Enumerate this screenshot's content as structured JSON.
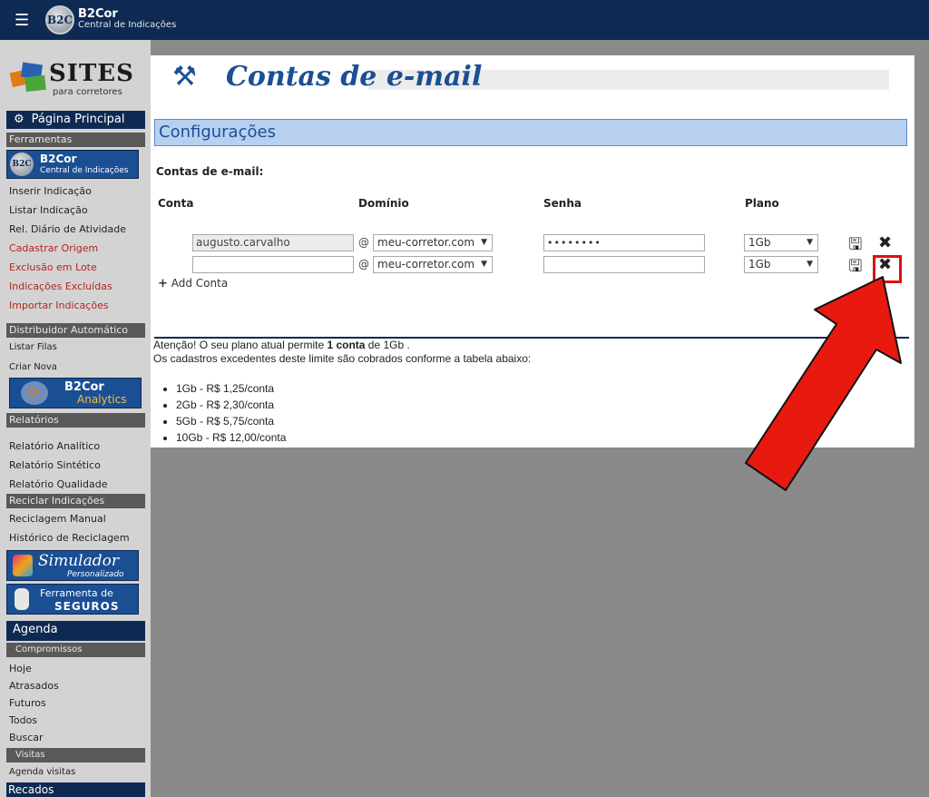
{
  "topbar": {
    "menu_icon": "hamburger-icon",
    "logo_text": "B2C",
    "brand_name": "B2Cor",
    "brand_sub": "Central de Indicações"
  },
  "sidebar": {
    "sites_logo": "SITES",
    "sites_sub": "para corretores",
    "home": "Página Principal",
    "ferramentas": "Ferramentas",
    "b2cor_banner": {
      "name": "B2Cor",
      "sub": "Central de Indicações"
    },
    "links_1": [
      "Inserir Indicação",
      "Listar Indicação",
      "Rel. Diário de Atividade"
    ],
    "links_red": [
      "Cadastrar Origem",
      "Exclusão em Lote",
      "Indicações Excluídas",
      "Importar Indicações"
    ],
    "distribuidor": "Distribuidor Automático",
    "links_2": [
      "Listar Filas",
      "Criar Nova"
    ],
    "analytics": {
      "name": "B2Cor",
      "sub": "Analytics"
    },
    "relatorios": "Relatórios",
    "links_3": [
      "Relatório Analítico",
      "Relatório Sintético",
      "Relatório Qualidade"
    ],
    "reciclar": "Reciclar Indicações",
    "links_4": [
      "Reciclagem Manual",
      "Histórico de Reciclagem"
    ],
    "simulador": {
      "name": "Simulador",
      "sub": "Personalizado"
    },
    "seguros": {
      "line1": "Ferramenta de",
      "line2": "SEGUROS"
    },
    "agenda": "Agenda",
    "compromissos": "Compromissos",
    "links_5": [
      "Hoje",
      "Atrasados",
      "Futuros",
      "Todos",
      "Buscar"
    ],
    "visitas": "Visitas",
    "agenda_visitas": "Agenda visitas",
    "recados": "Recados"
  },
  "main": {
    "page_title": "Contas de e-mail",
    "section_title": "Configurações",
    "sub_title": "Contas de e-mail:",
    "columns": [
      "Conta",
      "Domínio",
      "Senha",
      "Plano"
    ],
    "rows": [
      {
        "conta": "augusto.carvalho",
        "dominio": "meu-corretor.com",
        "senha": "••••••••",
        "plano": "1Gb"
      },
      {
        "conta": "",
        "dominio": "meu-corretor.com",
        "senha": "",
        "plano": "1Gb"
      }
    ],
    "at_sign": "@",
    "add_conta": "Add Conta",
    "notice_pre": "Atenção! O seu plano atual permite ",
    "notice_bold": "1 conta",
    "notice_post": " de 1Gb .",
    "notice_line2": "Os cadastros excedentes deste limite são cobrados conforme a tabela abaixo:",
    "prices": [
      "1Gb - R$ 1,25/conta",
      "2Gb - R$ 2,30/conta",
      "5Gb - R$ 5,75/conta",
      "10Gb - R$ 12,00/conta"
    ]
  },
  "colors": {
    "navy": "#0f2a52",
    "blue": "#1b4f94",
    "config_bg": "#b7d0f0",
    "arrow": "#e81a10"
  }
}
